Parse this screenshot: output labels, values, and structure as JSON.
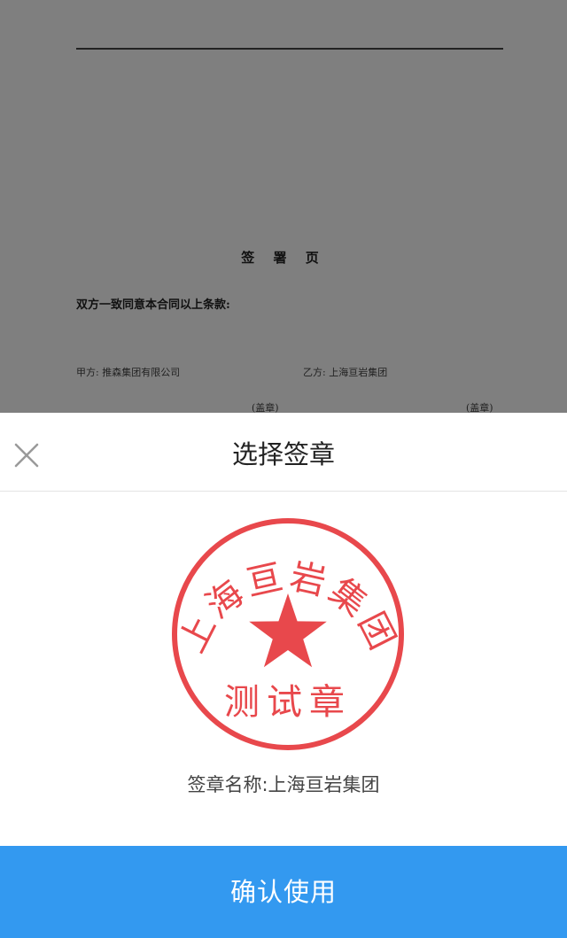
{
  "document": {
    "heading": "签 署 页",
    "intro": "双方一致同意本合同以上条款:",
    "party_a": "甲方:  推森集团有限公司",
    "party_b": "乙方:  上海亘岩集团",
    "seal_label_a": "(盖章)",
    "seal_label_b": "(盖章)"
  },
  "sheet": {
    "title": "选择签章",
    "close_icon": "close-icon",
    "seal": {
      "arc_text": "上海亘岩集团",
      "center_text": "测试章",
      "emblem": "star",
      "color": "#e8484c"
    },
    "seal_name": "签章名称:上海亘岩集团",
    "confirm_label": "确认使用",
    "confirm_color": "#3399f0"
  }
}
